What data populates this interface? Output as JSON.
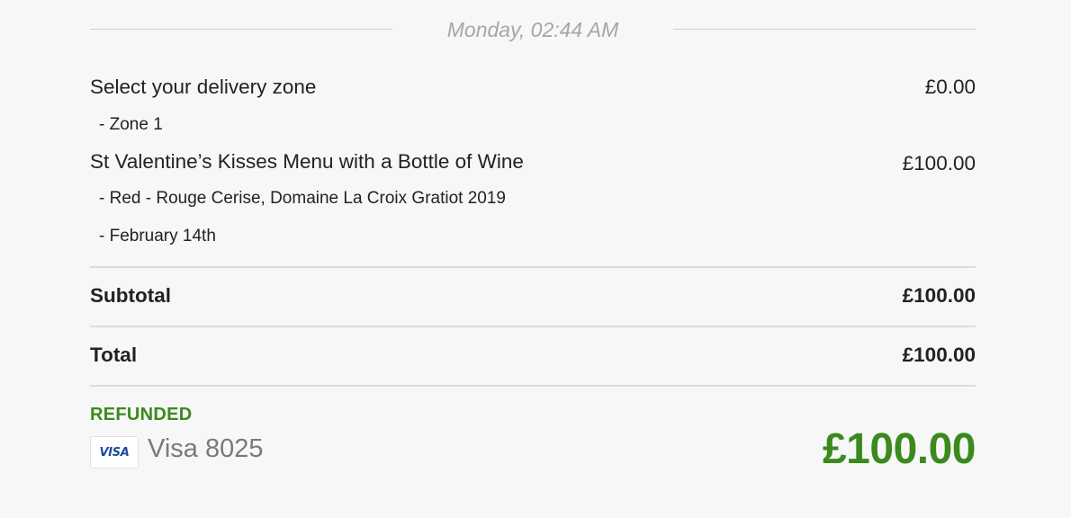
{
  "header": {
    "timestamp": "Monday, 02:44 AM"
  },
  "line_items": [
    {
      "name": "Select your delivery zone",
      "price": "£0.00",
      "options": [
        "- Zone 1"
      ]
    },
    {
      "name": "St Valentine’s Kisses Menu with a Bottle of Wine",
      "price": "£100.00",
      "options": [
        "- Red - Rouge Cerise, Domaine La Croix Gratiot 2019",
        "- February 14th"
      ]
    }
  ],
  "summary": {
    "subtotal_label": "Subtotal",
    "subtotal_value": "£100.00",
    "total_label": "Total",
    "total_value": "£100.00"
  },
  "payment": {
    "status": "REFUNDED",
    "card_logo_text": "VISA",
    "card_label": "Visa 8025",
    "amount": "£100.00",
    "status_color": "#3a8a1e"
  }
}
